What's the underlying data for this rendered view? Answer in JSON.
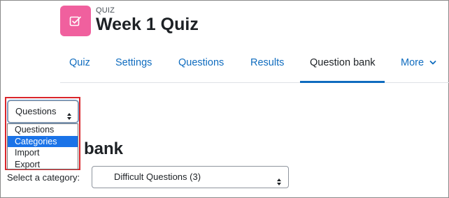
{
  "header": {
    "kicker": "QUIZ",
    "title": "Week 1 Quiz",
    "icon": "quiz-edit-icon",
    "icon_color": "#f0609e"
  },
  "nav": {
    "items": [
      {
        "label": "Quiz",
        "active": false
      },
      {
        "label": "Settings",
        "active": false
      },
      {
        "label": "Questions",
        "active": false
      },
      {
        "label": "Results",
        "active": false
      },
      {
        "label": "Question bank",
        "active": true
      },
      {
        "label": "More",
        "active": false
      }
    ],
    "link_color": "#0f6cbf"
  },
  "selector": {
    "value": "Questions",
    "options": [
      "Questions",
      "Categories",
      "Import",
      "Export"
    ],
    "highlighted": "Categories",
    "highlight_color": "#1a73e8",
    "annotation_color": "#d9262b"
  },
  "page": {
    "heading_visible": "bank"
  },
  "category": {
    "label": "Select a category:",
    "value": "Difficult Questions (3)"
  }
}
